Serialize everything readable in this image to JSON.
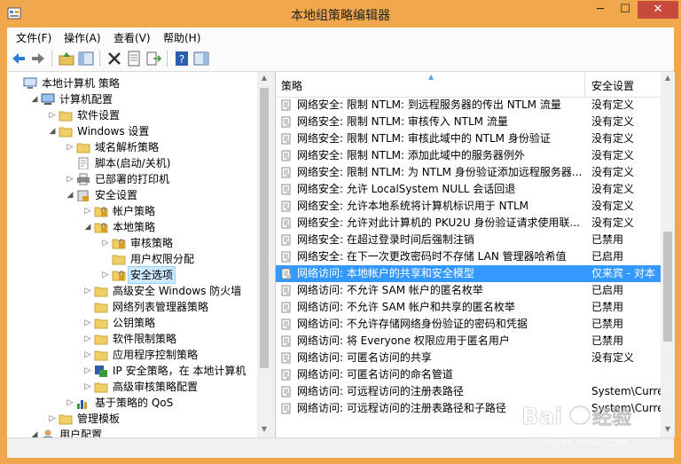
{
  "window": {
    "title": "本地组策略编辑器"
  },
  "menu": [
    "文件(F)",
    "操作(A)",
    "查看(V)",
    "帮助(H)"
  ],
  "toolbar": [
    "back-icon",
    "forward-icon",
    "up-folder-icon",
    "show-hide-tree-icon",
    "delete-icon",
    "properties-icon",
    "export-list-icon",
    "help-icon",
    "show-hide-action-pane-icon"
  ],
  "tree": [
    {
      "label": "本地计算机 策略",
      "exp": "",
      "icon": "computer-icon",
      "level": 0
    },
    {
      "label": "计算机配置",
      "exp": "◢",
      "icon": "computer-config-icon",
      "level": 1
    },
    {
      "label": "软件设置",
      "exp": "▷",
      "icon": "folder-icon",
      "level": 2
    },
    {
      "label": "Windows 设置",
      "exp": "◢",
      "icon": "folder-icon",
      "level": 2
    },
    {
      "label": "域名解析策略",
      "exp": "▷",
      "icon": "folder-icon",
      "level": 3
    },
    {
      "label": "脚本(启动/关机)",
      "exp": "",
      "icon": "script-icon",
      "level": 3
    },
    {
      "label": "已部署的打印机",
      "exp": "▷",
      "icon": "printer-icon",
      "level": 3
    },
    {
      "label": "安全设置",
      "exp": "◢",
      "icon": "security-icon",
      "level": 3
    },
    {
      "label": "帐户策略",
      "exp": "▷",
      "icon": "security-folder-icon",
      "level": 4
    },
    {
      "label": "本地策略",
      "exp": "◢",
      "icon": "security-folder-icon",
      "level": 4
    },
    {
      "label": "审核策略",
      "exp": "▷",
      "icon": "security-folder-icon",
      "level": 5
    },
    {
      "label": "用户权限分配",
      "exp": "",
      "icon": "folder-icon",
      "level": 5
    },
    {
      "label": "安全选项",
      "exp": "▷",
      "icon": "security-folder-icon",
      "level": 5,
      "selected": true
    },
    {
      "label": "高级安全 Windows 防火墙",
      "exp": "▷",
      "icon": "folder-icon",
      "level": 4
    },
    {
      "label": "网络列表管理器策略",
      "exp": "",
      "icon": "folder-icon",
      "level": 4
    },
    {
      "label": "公钥策略",
      "exp": "▷",
      "icon": "folder-icon",
      "level": 4
    },
    {
      "label": "软件限制策略",
      "exp": "▷",
      "icon": "folder-icon",
      "level": 4
    },
    {
      "label": "应用程序控制策略",
      "exp": "▷",
      "icon": "folder-icon",
      "level": 4
    },
    {
      "label": "IP 安全策略，在 本地计算机",
      "exp": "▷",
      "icon": "ip-security-icon",
      "level": 4
    },
    {
      "label": "高级审核策略配置",
      "exp": "▷",
      "icon": "folder-icon",
      "level": 4
    },
    {
      "label": "基于策略的 QoS",
      "exp": "▷",
      "icon": "qos-chart-icon",
      "level": 3
    },
    {
      "label": "管理模板",
      "exp": "▷",
      "icon": "folder-icon",
      "level": 2
    },
    {
      "label": "用户配置",
      "exp": "◢",
      "icon": "user-config-icon",
      "level": 1
    }
  ],
  "list": {
    "headers": {
      "policy": "策略",
      "setting": "安全设置"
    },
    "rows": [
      {
        "policy": "网络安全: 限制 NTLM: 到远程服务器的传出 NTLM 流量",
        "setting": "没有定义"
      },
      {
        "policy": "网络安全: 限制 NTLM: 审核传入 NTLM 流量",
        "setting": "没有定义"
      },
      {
        "policy": "网络安全: 限制 NTLM: 审核此域中的 NTLM 身份验证",
        "setting": "没有定义"
      },
      {
        "policy": "网络安全: 限制 NTLM: 添加此域中的服务器例外",
        "setting": "没有定义"
      },
      {
        "policy": "网络安全: 限制 NTLM: 为 NTLM 身份验证添加远程服务器...",
        "setting": "没有定义"
      },
      {
        "policy": "网络安全: 允许 LocalSystem NULL 会话回退",
        "setting": "没有定义"
      },
      {
        "policy": "网络安全: 允许本地系统将计算机标识用于 NTLM",
        "setting": "没有定义"
      },
      {
        "policy": "网络安全: 允许对此计算机的 PKU2U 身份验证请求使用联...",
        "setting": "没有定义"
      },
      {
        "policy": "网络安全: 在超过登录时间后强制注销",
        "setting": "已禁用"
      },
      {
        "policy": "网络安全: 在下一次更改密码时不存储 LAN 管理器哈希值",
        "setting": "已启用"
      },
      {
        "policy": "网络访问: 本地帐户的共享和安全模型",
        "setting": "仅来宾 - 对本",
        "selected": true
      },
      {
        "policy": "网络访问: 不允许 SAM 帐户的匿名枚举",
        "setting": "已启用"
      },
      {
        "policy": "网络访问: 不允许 SAM 帐户和共享的匿名枚举",
        "setting": "已禁用"
      },
      {
        "policy": "网络访问: 不允许存储网络身份验证的密码和凭据",
        "setting": "已禁用"
      },
      {
        "policy": "网络访问: 将 Everyone 权限应用于匿名用户",
        "setting": "已禁用"
      },
      {
        "policy": "网络访问: 可匿名访问的共享",
        "setting": "没有定义"
      },
      {
        "policy": "网络访问: 可匿名访问的命名管道",
        "setting": ""
      },
      {
        "policy": "网络访问: 可远程访问的注册表路径",
        "setting": "System\\Curre"
      },
      {
        "policy": "网络访问: 可远程访问的注册表路径和子路径",
        "setting": "System\\Curre"
      }
    ]
  },
  "watermark": {
    "text": "Baidu经验",
    "sub": "jingyan.baidu.com"
  },
  "colors": {
    "frame": "#f1a84d",
    "selection": "#3399ff",
    "tree_selection": "#cde8ff",
    "close": "#c74a3a"
  }
}
